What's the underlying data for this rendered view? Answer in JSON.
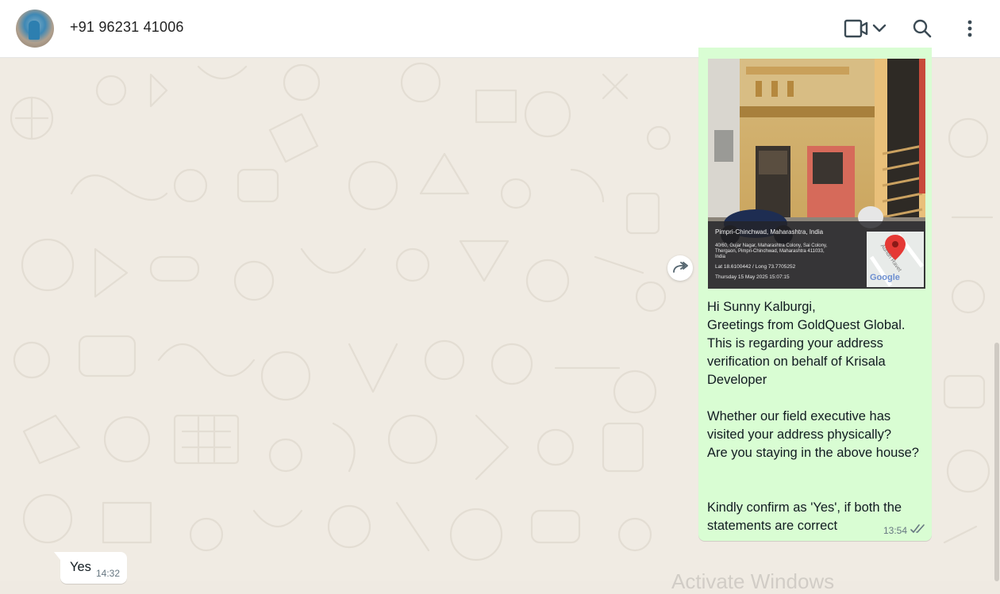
{
  "header": {
    "contact_name": "+91 96231 41006",
    "icons": [
      "avatar",
      "video-call-icon",
      "chevron-down-icon",
      "search-icon",
      "more-vertical-icon"
    ]
  },
  "photo": {
    "location_title": "Pimpri-Chinchwad, Maharashtra, India",
    "address_line1": "40/60, Gujar Nagar, Maharashtra Colony, Sai Colony,",
    "address_line2": "Thergaon, Pimpri-Chinchwad, Maharashtra 411033,",
    "address_line3": "India",
    "coords": "Lat 18.6100442 / Long 73.7705252",
    "timestamp": "Thursday 15 May 2025 15:07:15",
    "map_road_label": "Aundh Ravet",
    "map_brand": "Google"
  },
  "outgoing_message": {
    "text": "Hi Sunny Kalburgi,\nGreetings from GoldQuest Global.\nThis is regarding your address verification on behalf of Krisala Developer\n\nWhether our field executive has visited your address physically?\nAre you staying in the above house?\n\n\nKindly confirm as 'Yes', if both the statements are correct",
    "time": "13:54",
    "status": "read"
  },
  "incoming_message": {
    "text": "Yes",
    "time": "14:32"
  },
  "watermark": "Activate Windows",
  "colors": {
    "outgoing_bubble": "#d9fdd3",
    "incoming_bubble": "#ffffff",
    "wallpaper": "#f0ebe3",
    "meta_text": "#667781"
  }
}
